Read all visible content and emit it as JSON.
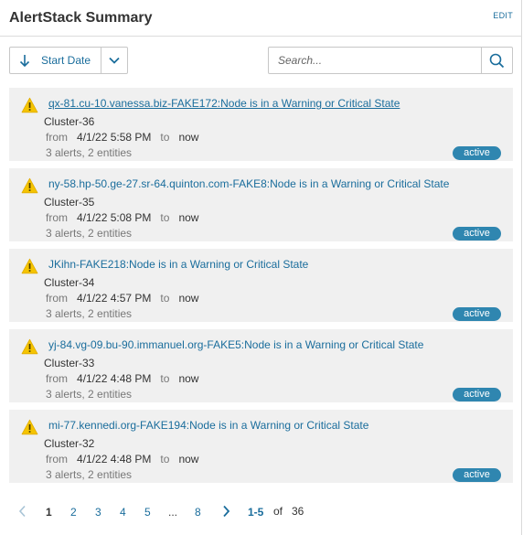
{
  "widget": {
    "title": "AlertStack Summary",
    "edit_label": "EDIT"
  },
  "toolbar": {
    "sort_label": "Start Date",
    "search_placeholder": "Search..."
  },
  "alerts": [
    {
      "name": "qx-81.cu-10.vanessa.biz-FAKE172:Node is in a Warning or Critical State",
      "cluster": "Cluster-36",
      "from_label": "from",
      "from": "4/1/22 5:58 PM",
      "to_label": "to",
      "to": "now",
      "counts": "3 alerts, 2 entities",
      "status": "active"
    },
    {
      "name": "ny-58.hp-50.ge-27.sr-64.quinton.com-FAKE8:Node is in a Warning or Critical State",
      "cluster": "Cluster-35",
      "from_label": "from",
      "from": "4/1/22 5:08 PM",
      "to_label": "to",
      "to": "now",
      "counts": "3 alerts, 2 entities",
      "status": "active"
    },
    {
      "name": "JKihn-FAKE218:Node is in a Warning or Critical State",
      "cluster": "Cluster-34",
      "from_label": "from",
      "from": "4/1/22 4:57 PM",
      "to_label": "to",
      "to": "now",
      "counts": "3 alerts, 2 entities",
      "status": "active"
    },
    {
      "name": "yj-84.vg-09.bu-90.immanuel.org-FAKE5:Node is in a Warning or Critical State",
      "cluster": "Cluster-33",
      "from_label": "from",
      "from": "4/1/22 4:48 PM",
      "to_label": "to",
      "to": "now",
      "counts": "3 alerts, 2 entities",
      "status": "active"
    },
    {
      "name": "mi-77.kennedi.org-FAKE194:Node is in a Warning or Critical State",
      "cluster": "Cluster-32",
      "from_label": "from",
      "from": "4/1/22 4:48 PM",
      "to_label": "to",
      "to": "now",
      "counts": "3 alerts, 2 entities",
      "status": "active"
    }
  ],
  "pagination": {
    "pages": [
      "1",
      "2",
      "3",
      "4",
      "5",
      "...",
      "8"
    ],
    "current": "1",
    "range": "1-5",
    "of_label": "of",
    "total": "36"
  },
  "colors": {
    "link": "#1a6d9c",
    "badge": "#2f86b0",
    "warning": "#f5c400",
    "card_bg": "#f0f0f0"
  },
  "icons": {
    "sort": "arrow-down-icon",
    "dropdown": "chevron-down-icon",
    "search": "search-icon",
    "alert": "warning-triangle-icon",
    "prev": "chevron-left-icon",
    "next": "chevron-right-icon"
  }
}
